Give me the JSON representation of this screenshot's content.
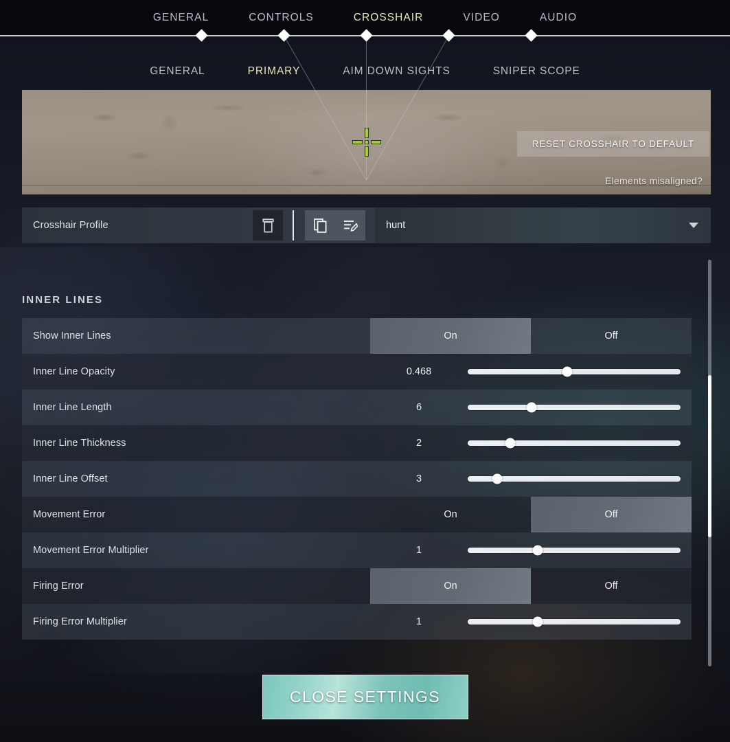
{
  "topnav": {
    "items": [
      {
        "label": "GENERAL",
        "active": false
      },
      {
        "label": "CONTROLS",
        "active": false
      },
      {
        "label": "CROSSHAIR",
        "active": true
      },
      {
        "label": "VIDEO",
        "active": false
      },
      {
        "label": "AUDIO",
        "active": false
      }
    ]
  },
  "subnav": {
    "items": [
      {
        "label": "GENERAL",
        "active": false
      },
      {
        "label": "PRIMARY",
        "active": true
      },
      {
        "label": "AIM DOWN SIGHTS",
        "active": false
      },
      {
        "label": "SNIPER SCOPE",
        "active": false
      }
    ]
  },
  "preview": {
    "reset_button": "RESET CROSSHAIR TO DEFAULT",
    "misaligned_link": "Elements misaligned?",
    "crosshair_color": "#9fcc2e"
  },
  "profile": {
    "label": "Crosshair Profile",
    "delete_icon": "trash-icon",
    "copy_icon": "copy-icon",
    "rename_icon": "rename-icon",
    "selected": "hunt",
    "caret_icon": "chevron-down-icon"
  },
  "section": {
    "title": "INNER LINES"
  },
  "settings": [
    {
      "label": "Show Inner Lines",
      "type": "toggle",
      "on_label": "On",
      "off_label": "Off",
      "selected": "On",
      "shade": "alt"
    },
    {
      "label": "Inner Line Opacity",
      "type": "slider",
      "value": "0.468",
      "percent": 46.8,
      "shade": "base"
    },
    {
      "label": "Inner Line Length",
      "type": "slider",
      "value": "6",
      "percent": 30.0,
      "shade": "alt"
    },
    {
      "label": "Inner Line Thickness",
      "type": "slider",
      "value": "2",
      "percent": 20.0,
      "shade": "base"
    },
    {
      "label": "Inner Line Offset",
      "type": "slider",
      "value": "3",
      "percent": 14.0,
      "shade": "alt"
    },
    {
      "label": "Movement Error",
      "type": "toggle",
      "on_label": "On",
      "off_label": "Off",
      "selected": "Off",
      "shade": "base"
    },
    {
      "label": "Movement Error Multiplier",
      "type": "slider",
      "value": "1",
      "percent": 33.0,
      "shade": "alt"
    },
    {
      "label": "Firing Error",
      "type": "toggle",
      "on_label": "On",
      "off_label": "Off",
      "selected": "On",
      "shade": "base"
    },
    {
      "label": "Firing Error Multiplier",
      "type": "slider",
      "value": "1",
      "percent": 33.0,
      "shade": "alt"
    }
  ],
  "footer": {
    "close_label": "CLOSE SETTINGS"
  },
  "colors": {
    "accent_yellow": "#ece8b4",
    "close_teal": "#8ed0c6",
    "row_alt": "#4a5460",
    "row_base": "#262c36"
  }
}
